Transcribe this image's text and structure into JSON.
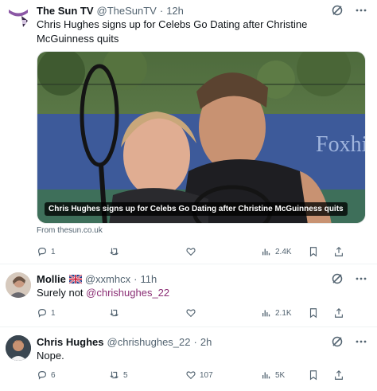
{
  "tweets": [
    {
      "name": "The Sun TV",
      "handle": "@TheSunTV",
      "dot": "·",
      "time": "12h",
      "text": "Chris Hughes signs up for Celebs Go Dating after Christine McGuinness quits",
      "card": {
        "caption": "Chris Hughes signs up for Celebs Go Dating after Christine McGuinness quits",
        "backdrop_text": "Foxhi",
        "source": "From thesun.co.uk"
      },
      "actions": {
        "replies": "1",
        "retweets": "",
        "likes": "",
        "views": "2.4K"
      }
    },
    {
      "name": "Mollie",
      "flag": "uk-flag",
      "handle": "@xxmhcx",
      "dot": "·",
      "time": "11h",
      "text_prefix": "Surely not ",
      "mention": "@chrishughes_22",
      "actions": {
        "replies": "1",
        "retweets": "",
        "likes": "",
        "views": "2.1K"
      }
    },
    {
      "name": "Chris Hughes",
      "handle": "@chrishughes_22",
      "dot": "·",
      "time": "2h",
      "text": "Nope.",
      "actions": {
        "replies": "6",
        "retweets": "5",
        "likes": "107",
        "views": "5K"
      }
    }
  ],
  "colors": {
    "text": "#0f1419",
    "muted": "#536471",
    "mention": "#8a2d74",
    "divider": "#eff3f4"
  }
}
